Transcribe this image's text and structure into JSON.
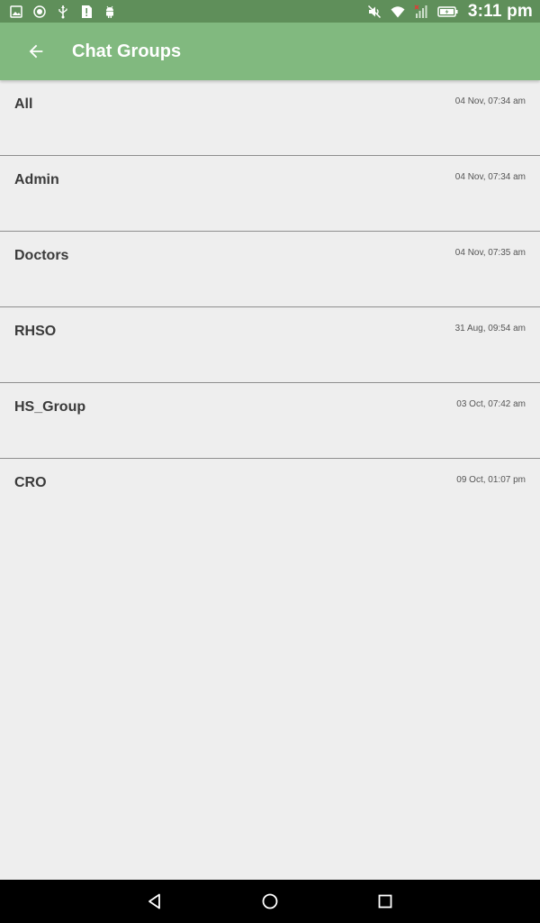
{
  "status_bar": {
    "time": "3:11 pm",
    "left_icons": [
      "image-icon",
      "location-icon",
      "usb-icon",
      "alert-icon",
      "android-icon"
    ],
    "right_icons": [
      "mute-icon",
      "wifi-icon",
      "signal-icon",
      "battery-charging-icon"
    ]
  },
  "app_bar": {
    "title": "Chat Groups",
    "back_icon": "arrow-back-icon"
  },
  "groups": [
    {
      "name": "All",
      "time": "04 Nov, 07:34 am"
    },
    {
      "name": "Admin",
      "time": "04 Nov, 07:34 am"
    },
    {
      "name": "Doctors",
      "time": "04 Nov, 07:35 am"
    },
    {
      "name": "RHSO",
      "time": "31 Aug, 09:54 am"
    },
    {
      "name": "HS_Group",
      "time": "03 Oct, 07:42 am"
    },
    {
      "name": "CRO",
      "time": "09 Oct, 01:07 pm"
    }
  ],
  "nav_bar": {
    "icons": [
      "nav-back-icon",
      "nav-home-icon",
      "nav-recents-icon"
    ]
  },
  "colors": {
    "status_bar": "#5f8f5a",
    "app_bar": "#81b97f",
    "background": "#eeeeee",
    "divider": "#8e8e8e"
  }
}
